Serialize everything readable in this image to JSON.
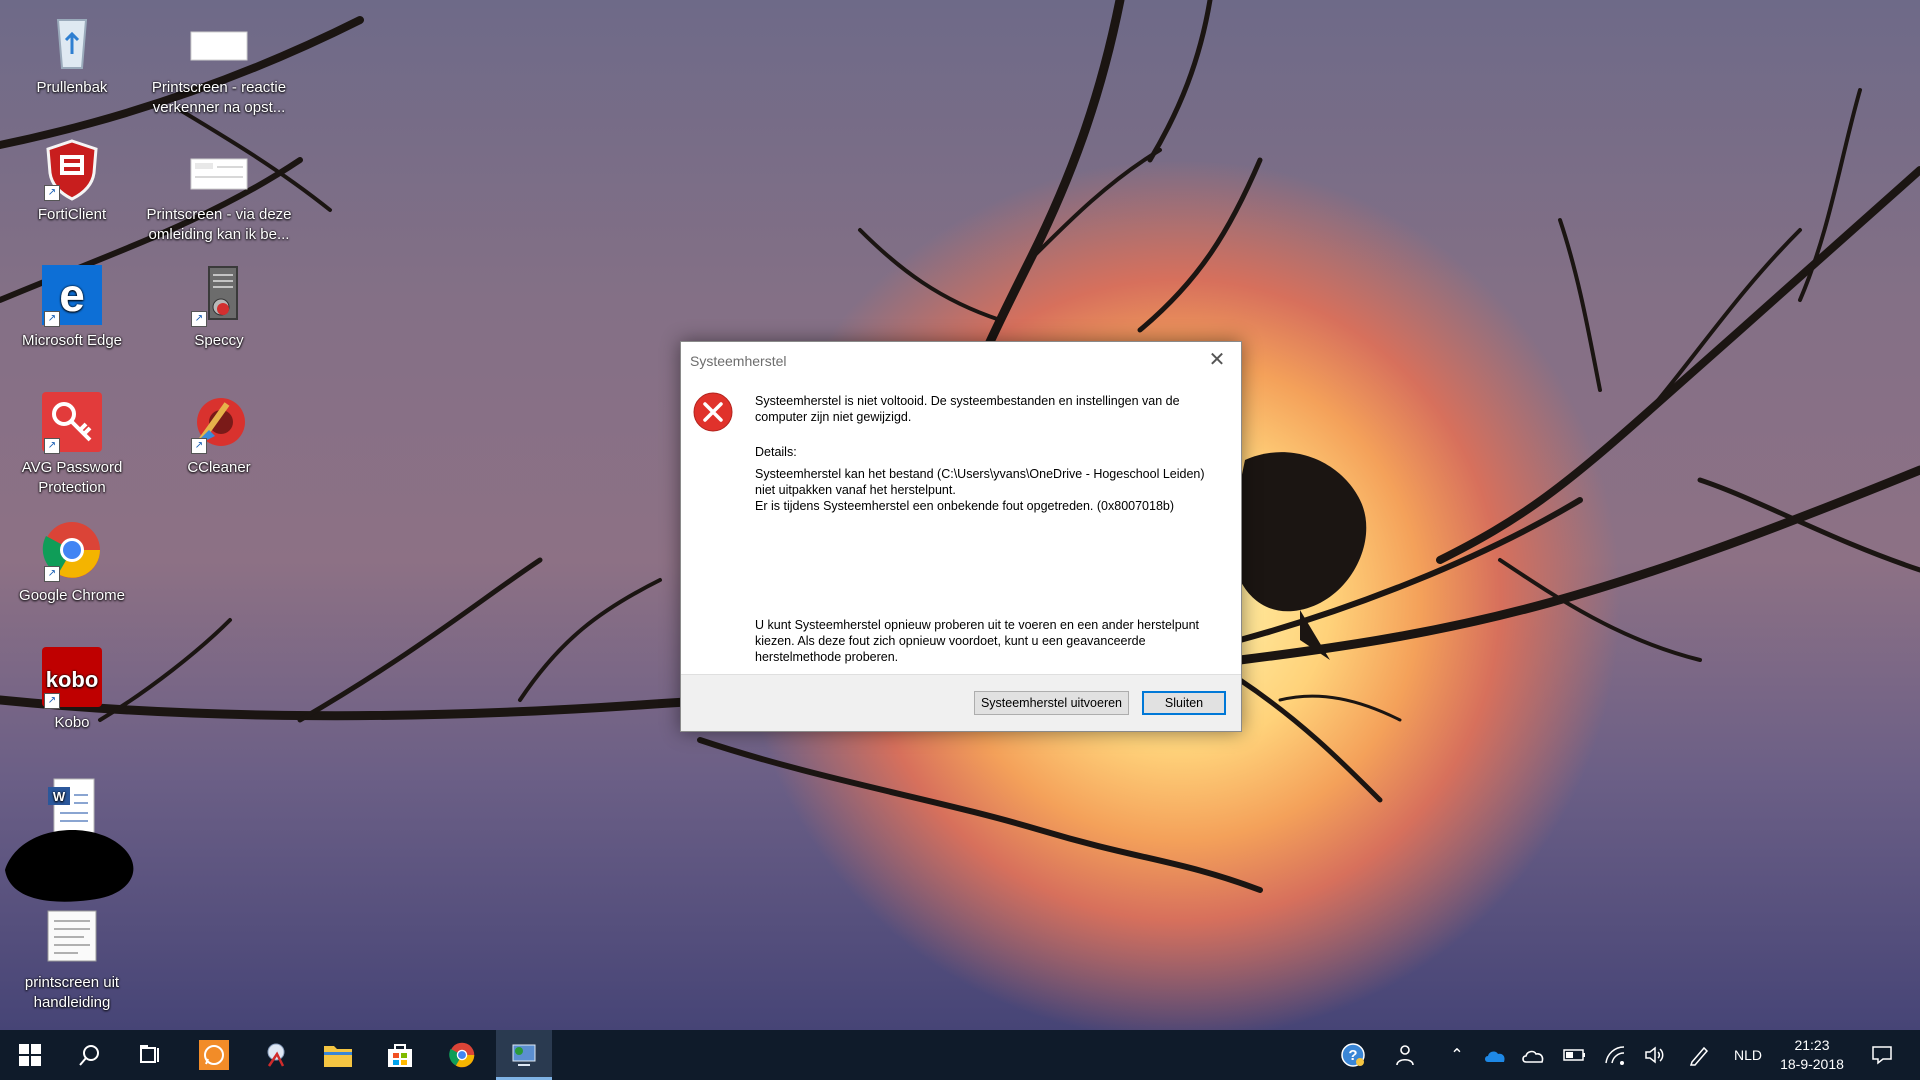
{
  "desktop": {
    "icons": [
      {
        "label": "Prullenbak"
      },
      {
        "label": "Printscreen - reactie verkenner na opst..."
      },
      {
        "label": "FortiClient"
      },
      {
        "label": "Printscreen - via deze omleiding kan ik be..."
      },
      {
        "label": "Microsoft Edge"
      },
      {
        "label": "Speccy"
      },
      {
        "label": "AVG Password Protection"
      },
      {
        "label": "CCleaner"
      },
      {
        "label": "Google Chrome"
      },
      {
        "label": "Kobo"
      },
      {
        "label": "printscreen uit handleiding"
      }
    ]
  },
  "dialog": {
    "title": "Systeemherstel",
    "message": "Systeemherstel is niet voltooid. De systeembestanden en instellingen van de computer zijn niet gewijzigd.",
    "details_label": "Details:",
    "details_line1": "Systeemherstel kan het bestand (C:\\Users\\yvans\\OneDrive - Hogeschool Leiden) niet uitpakken vanaf het herstelpunt.",
    "details_line2": "Er is tijdens Systeemherstel een onbekende fout opgetreden. (0x8007018b)",
    "advice": "U kunt Systeemherstel opnieuw proberen uit te voeren en een ander herstelpunt kiezen. Als deze fout zich opnieuw voordoet, kunt u een geavanceerde herstelmethode proberen.",
    "run_button": "Systeemherstel uitvoeren",
    "close_button": "Sluiten"
  },
  "taskbar": {
    "language": "NLD",
    "time": "21:23",
    "date": "18-9-2018"
  },
  "colors": {
    "taskbar_bg": "#0f1b2a",
    "accent": "#0078d7",
    "error_red": "#e0322b"
  }
}
